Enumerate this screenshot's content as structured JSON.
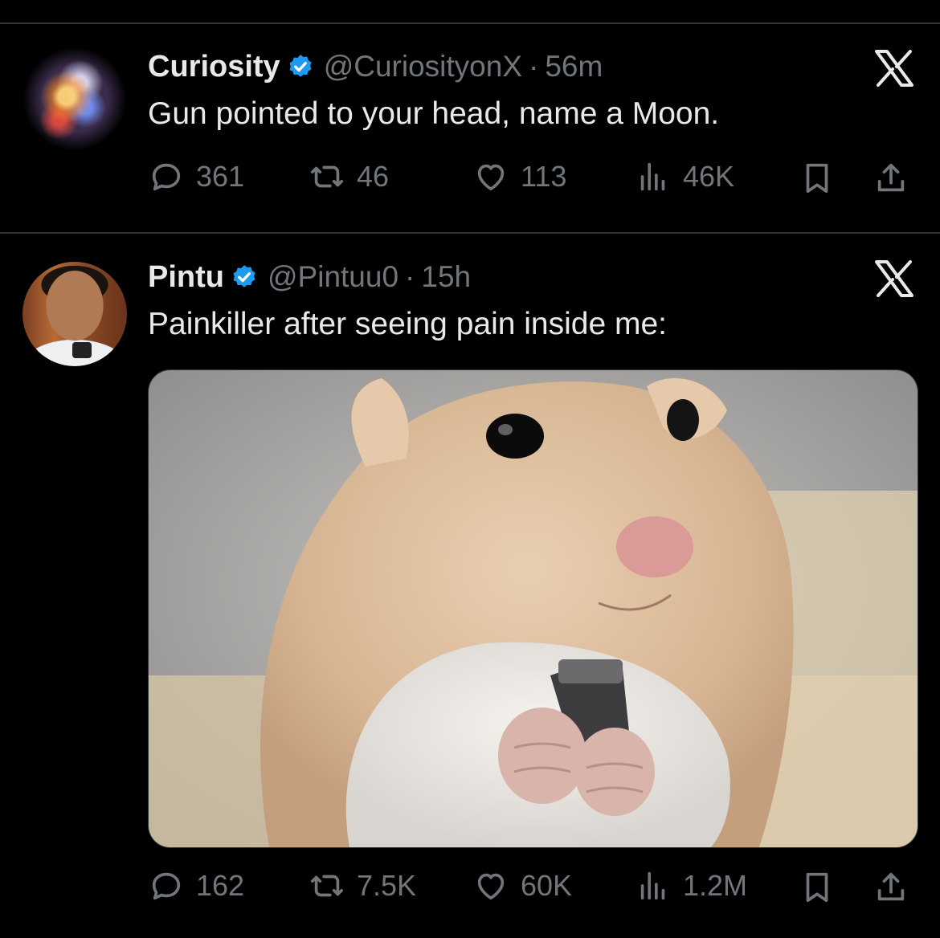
{
  "tweets": [
    {
      "name": "Curiosity",
      "handle": "@CuriosityonX",
      "separator": "·",
      "time": "56m",
      "text": "Gun pointed to your head, name a Moon.",
      "stats": {
        "replies": "361",
        "reposts": "46",
        "likes": "113",
        "views": "46K"
      }
    },
    {
      "name": "Pintu",
      "handle": "@Pintuu0",
      "separator": "·",
      "time": "15h",
      "text": "Painkiller after seeing pain inside me:",
      "stats": {
        "replies": "162",
        "reposts": "7.5K",
        "likes": "60K",
        "views": "1.2M"
      }
    }
  ],
  "colors": {
    "background": "#000000",
    "primary_text": "#e7e9ea",
    "secondary_text": "#71767b",
    "verified": "#1d9bf0",
    "divider": "#2f3336"
  },
  "icons": [
    "verified-badge-icon",
    "x-logo-icon",
    "reply-icon",
    "repost-icon",
    "like-icon",
    "views-icon",
    "bookmark-icon",
    "share-icon"
  ]
}
